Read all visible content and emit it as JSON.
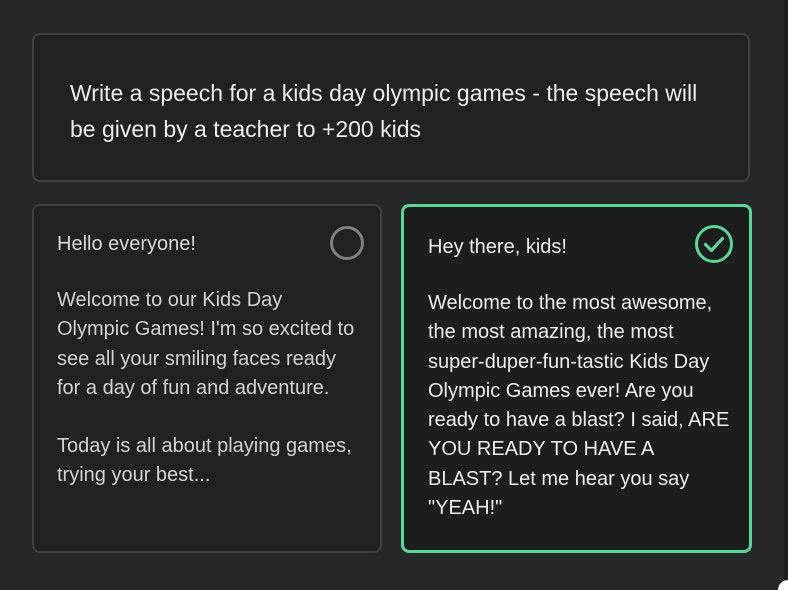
{
  "prompt": {
    "text": "Write a speech for a kids day olympic games - the speech will be given by a teacher to +200 kids"
  },
  "responses": [
    {
      "greeting": "Hello everyone!",
      "paragraphs": [
        "Welcome to our Kids Day Olympic Games! I'm so excited to see all your smiling faces ready for a day of fun and adventure.",
        "Today is all about playing games, trying your best..."
      ],
      "selected": false,
      "indicator_icon": "empty-circle-icon"
    },
    {
      "greeting": "Hey there, kids!",
      "paragraphs": [
        "Welcome to the most awesome, the most amazing, the most super-duper-fun-tastic Kids Day Olympic Games ever! Are you ready to have a blast? I said, ARE YOU READY TO HAVE A BLAST? Let me hear you say \"YEAH!\""
      ],
      "selected": true,
      "indicator_icon": "check-circle-icon"
    }
  ],
  "colors": {
    "background": "#262727",
    "card": "#202121",
    "border": "#3f4041",
    "accent": "#5ed498"
  }
}
